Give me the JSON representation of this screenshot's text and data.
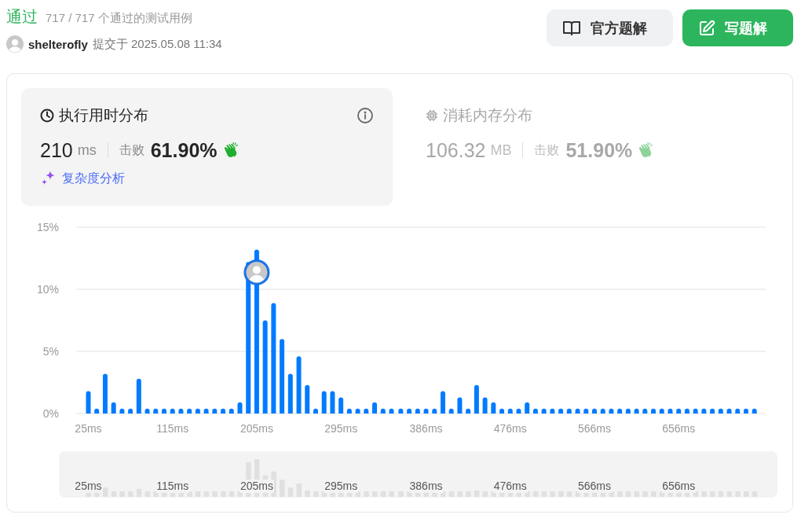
{
  "header": {
    "status": "通过",
    "testcases": "717 / 717 个通过的测试用例",
    "user": "shelterofly",
    "submitted": "提交于 2025.05.08 11:34"
  },
  "buttons": [
    {
      "kind": "official",
      "label": "官方题解"
    },
    {
      "kind": "write",
      "label": "写题解"
    }
  ],
  "stats": [
    {
      "kind": "runtime",
      "title": "执行用时分布",
      "value": "210",
      "unit": "ms",
      "beats_label": "击败",
      "beats": "61.90%",
      "selected": true,
      "analysis": "复杂度分析"
    },
    {
      "kind": "memory",
      "title": "消耗内存分布",
      "value": "106.32",
      "unit": "MB",
      "beats_label": "击败",
      "beats": "51.90%",
      "selected": false
    }
  ],
  "chart": {
    "chart_data": {
      "type": "bar",
      "x": [
        25,
        34,
        43,
        52,
        61,
        70,
        79,
        88,
        97,
        106,
        115,
        124,
        133,
        142,
        151,
        160,
        169,
        178,
        187,
        196,
        205,
        214,
        223,
        232,
        241,
        250,
        259,
        268,
        277,
        286,
        295,
        304,
        313,
        322,
        331,
        340,
        349,
        359,
        368,
        377,
        386,
        395,
        404,
        413,
        422,
        431,
        440,
        449,
        458,
        467,
        476,
        485,
        494,
        503,
        512,
        521,
        530,
        539,
        548,
        557,
        566,
        575,
        584,
        593,
        602,
        611,
        620,
        629,
        638,
        647,
        656,
        665,
        674,
        683,
        692,
        701,
        710,
        719,
        728,
        737
      ],
      "values": [
        1.8,
        0.4,
        3.2,
        0.9,
        0.4,
        0.4,
        2.8,
        0.4,
        0.4,
        0.4,
        0.4,
        0.4,
        0.4,
        0.4,
        0.4,
        0.4,
        0.4,
        0.4,
        0.9,
        12.2,
        13.2,
        7.5,
        8.9,
        6.0,
        3.2,
        4.6,
        2.3,
        0.4,
        1.8,
        1.8,
        1.3,
        0.4,
        0.4,
        0.4,
        0.9,
        0.4,
        0.4,
        0.4,
        0.4,
        0.4,
        0.4,
        0.4,
        1.8,
        0.4,
        1.3,
        0.4,
        2.3,
        1.3,
        0.9,
        0.4,
        0.4,
        0.4,
        0.9,
        0.4,
        0.4,
        0.4,
        0.4,
        0.4,
        0.4,
        0.4,
        0.4,
        0.4,
        0.4,
        0.4,
        0.4,
        0.4,
        0.4,
        0.4,
        0.4,
        0.4,
        0.4,
        0.4,
        0.4,
        0.4,
        0.4,
        0.4,
        0.4,
        0.4,
        0.4,
        0.4
      ],
      "xlim": [
        12,
        749
      ],
      "ylim": [
        0,
        15
      ],
      "yticks": [
        {
          "value": 0,
          "label": "0%"
        },
        {
          "value": 5,
          "label": "5%"
        },
        {
          "value": 10,
          "label": "10%"
        },
        {
          "value": 15,
          "label": "15%"
        }
      ],
      "xticks": [
        {
          "value": 25,
          "label": "25ms"
        },
        {
          "value": 115,
          "label": "115ms"
        },
        {
          "value": 205,
          "label": "205ms"
        },
        {
          "value": 295,
          "label": "295ms"
        },
        {
          "value": 386,
          "label": "386ms"
        },
        {
          "value": 476,
          "label": "476ms"
        },
        {
          "value": 566,
          "label": "566ms"
        },
        {
          "value": 656,
          "label": "656ms"
        }
      ]
    },
    "bars": [
      {
        "selected": false
      },
      {
        "selected": false
      },
      {
        "selected": false
      },
      {
        "selected": false
      },
      {
        "selected": false
      },
      {
        "selected": false
      },
      {
        "selected": false
      },
      {
        "selected": false
      },
      {
        "selected": false
      },
      {
        "selected": false
      },
      {
        "selected": false
      },
      {
        "selected": false
      },
      {
        "selected": false
      },
      {
        "selected": false
      },
      {
        "selected": false
      },
      {
        "selected": false
      },
      {
        "selected": false
      },
      {
        "selected": false
      },
      {
        "selected": false
      },
      {
        "selected": false
      },
      {
        "selected": true
      },
      {
        "selected": false
      },
      {
        "selected": false
      },
      {
        "selected": false
      },
      {
        "selected": false
      },
      {
        "selected": false
      },
      {
        "selected": false
      },
      {
        "selected": false
      },
      {
        "selected": false
      },
      {
        "selected": false
      },
      {
        "selected": false
      },
      {
        "selected": false
      },
      {
        "selected": false
      },
      {
        "selected": false
      },
      {
        "selected": false
      },
      {
        "selected": false
      },
      {
        "selected": false
      },
      {
        "selected": false
      },
      {
        "selected": false
      },
      {
        "selected": false
      },
      {
        "selected": false
      },
      {
        "selected": false
      },
      {
        "selected": false
      },
      {
        "selected": false
      },
      {
        "selected": false
      },
      {
        "selected": false
      },
      {
        "selected": false
      },
      {
        "selected": false
      },
      {
        "selected": false
      },
      {
        "selected": false
      },
      {
        "selected": false
      },
      {
        "selected": false
      },
      {
        "selected": false
      },
      {
        "selected": false
      },
      {
        "selected": false
      },
      {
        "selected": false
      },
      {
        "selected": false
      },
      {
        "selected": false
      },
      {
        "selected": false
      },
      {
        "selected": false
      },
      {
        "selected": false
      },
      {
        "selected": false
      },
      {
        "selected": false
      },
      {
        "selected": false
      },
      {
        "selected": false
      },
      {
        "selected": false
      },
      {
        "selected": false
      },
      {
        "selected": false
      },
      {
        "selected": false
      },
      {
        "selected": false
      },
      {
        "selected": false
      },
      {
        "selected": false
      },
      {
        "selected": false
      },
      {
        "selected": false
      },
      {
        "selected": false
      },
      {
        "selected": false
      },
      {
        "selected": false
      },
      {
        "selected": false
      },
      {
        "selected": false
      },
      {
        "selected": false
      }
    ]
  },
  "overview": {
    "tick_labels": [
      "25ms",
      "115ms",
      "205ms",
      "295ms",
      "386ms",
      "476ms",
      "566ms",
      "656ms"
    ]
  }
}
